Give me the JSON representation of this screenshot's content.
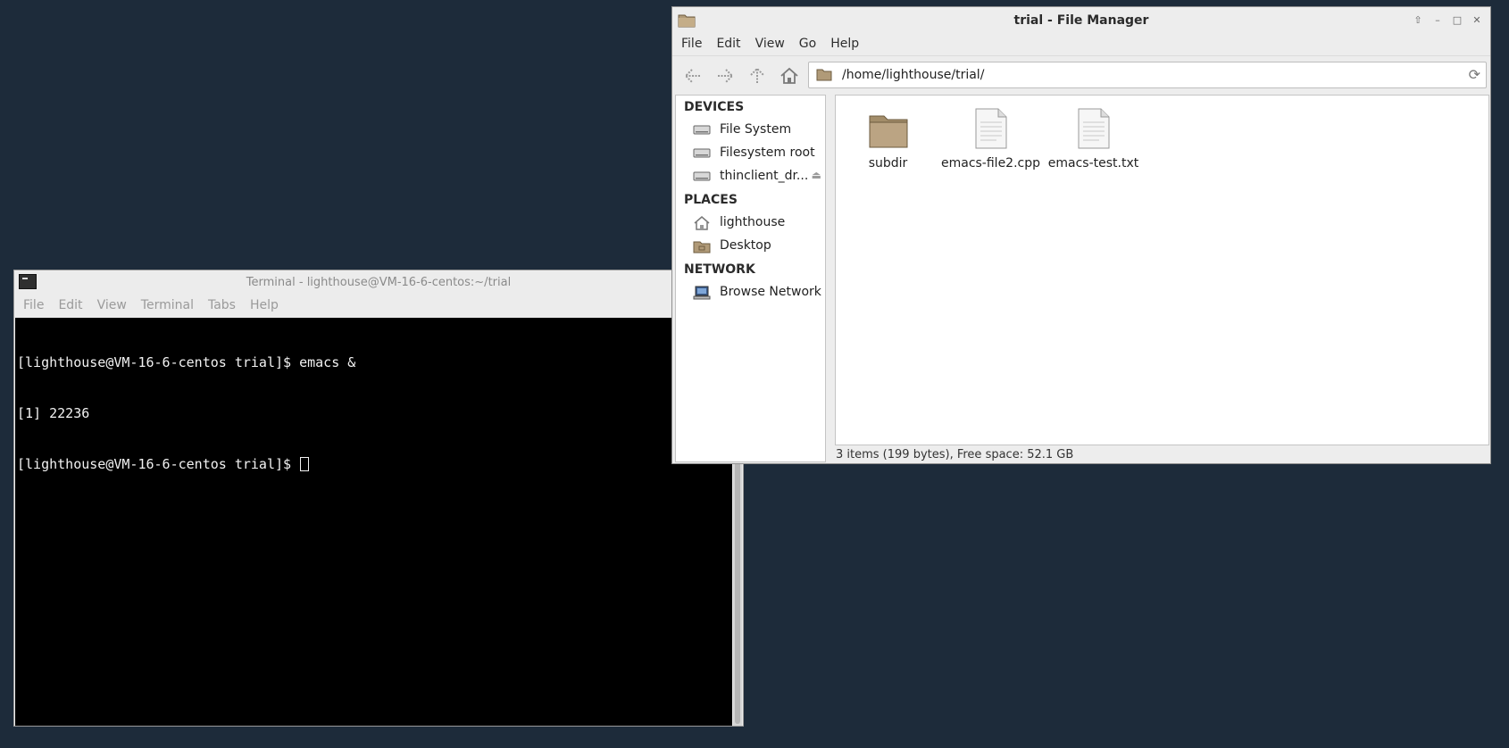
{
  "terminal": {
    "title": "Terminal - lighthouse@VM-16-6-centos:~/trial",
    "menu": [
      "File",
      "Edit",
      "View",
      "Terminal",
      "Tabs",
      "Help"
    ],
    "lines": [
      "[lighthouse@VM-16-6-centos trial]$ emacs &",
      "[1] 22236",
      "[lighthouse@VM-16-6-centos trial]$ "
    ]
  },
  "file_manager": {
    "title": "trial - File Manager",
    "menu": [
      "File",
      "Edit",
      "View",
      "Go",
      "Help"
    ],
    "location": "/home/lighthouse/trial/",
    "sidebar": {
      "devices_heading": "DEVICES",
      "devices": [
        {
          "label": "File System",
          "icon": "drive-icon"
        },
        {
          "label": "Filesystem root",
          "icon": "drive-icon"
        },
        {
          "label": "thinclient_dr...",
          "icon": "drive-icon"
        }
      ],
      "places_heading": "PLACES",
      "places": [
        {
          "label": "lighthouse",
          "icon": "home-icon"
        },
        {
          "label": "Desktop",
          "icon": "folder-icon"
        }
      ],
      "network_heading": "NETWORK",
      "network": [
        {
          "label": "Browse Network",
          "icon": "network-icon"
        }
      ]
    },
    "files": [
      {
        "name": "subdir",
        "type": "folder"
      },
      {
        "name": "emacs-file2.cpp",
        "type": "file"
      },
      {
        "name": "emacs-test.txt",
        "type": "file"
      }
    ],
    "status": "3 items (199 bytes), Free space: 52.1 GB"
  }
}
